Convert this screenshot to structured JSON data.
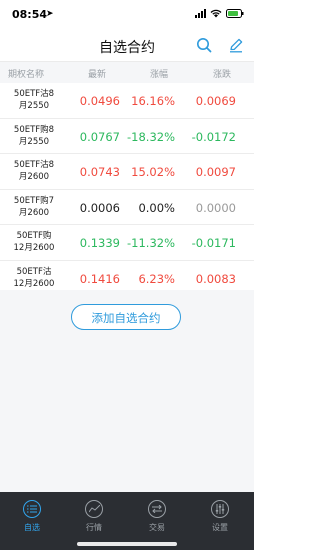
{
  "status": {
    "time": "08:54"
  },
  "nav": {
    "title": "自选合约"
  },
  "table": {
    "headers": [
      "期权名称",
      "最新",
      "涨幅",
      "涨跌"
    ],
    "rows": [
      {
        "name1": "50ETF沽8",
        "name2": "月2550",
        "price": "0.0496",
        "rate": "16.16%",
        "change": "0.0069"
      },
      {
        "name1": "50ETF购8",
        "name2": "月2550",
        "price": "0.0767",
        "rate": "-18.32%",
        "change": "-0.0172"
      },
      {
        "name1": "50ETF沽8",
        "name2": "月2600",
        "price": "0.0743",
        "rate": "15.02%",
        "change": "0.0097"
      },
      {
        "name1": "50ETF购7",
        "name2": "月2600",
        "price": "0.0006",
        "rate": "0.00%",
        "change": "0.0000"
      },
      {
        "name1": "50ETF购",
        "name2": "12月2600",
        "price": "0.1339",
        "rate": "-11.32%",
        "change": "-0.0171"
      },
      {
        "name1": "50ETF沽",
        "name2": "12月2600",
        "price": "0.1416",
        "rate": "6.23%",
        "change": "0.0083"
      }
    ]
  },
  "add_button": {
    "label": "添加自选合约"
  },
  "tabs": [
    {
      "label": "自选",
      "active": true
    },
    {
      "label": "行情",
      "active": false
    },
    {
      "label": "交易",
      "active": false
    },
    {
      "label": "设置",
      "active": false
    }
  ],
  "colors": {
    "up": "#f04a3e",
    "down": "#2cb85e",
    "accent": "#2f9bdc",
    "tabbar": "#2b2e33"
  }
}
